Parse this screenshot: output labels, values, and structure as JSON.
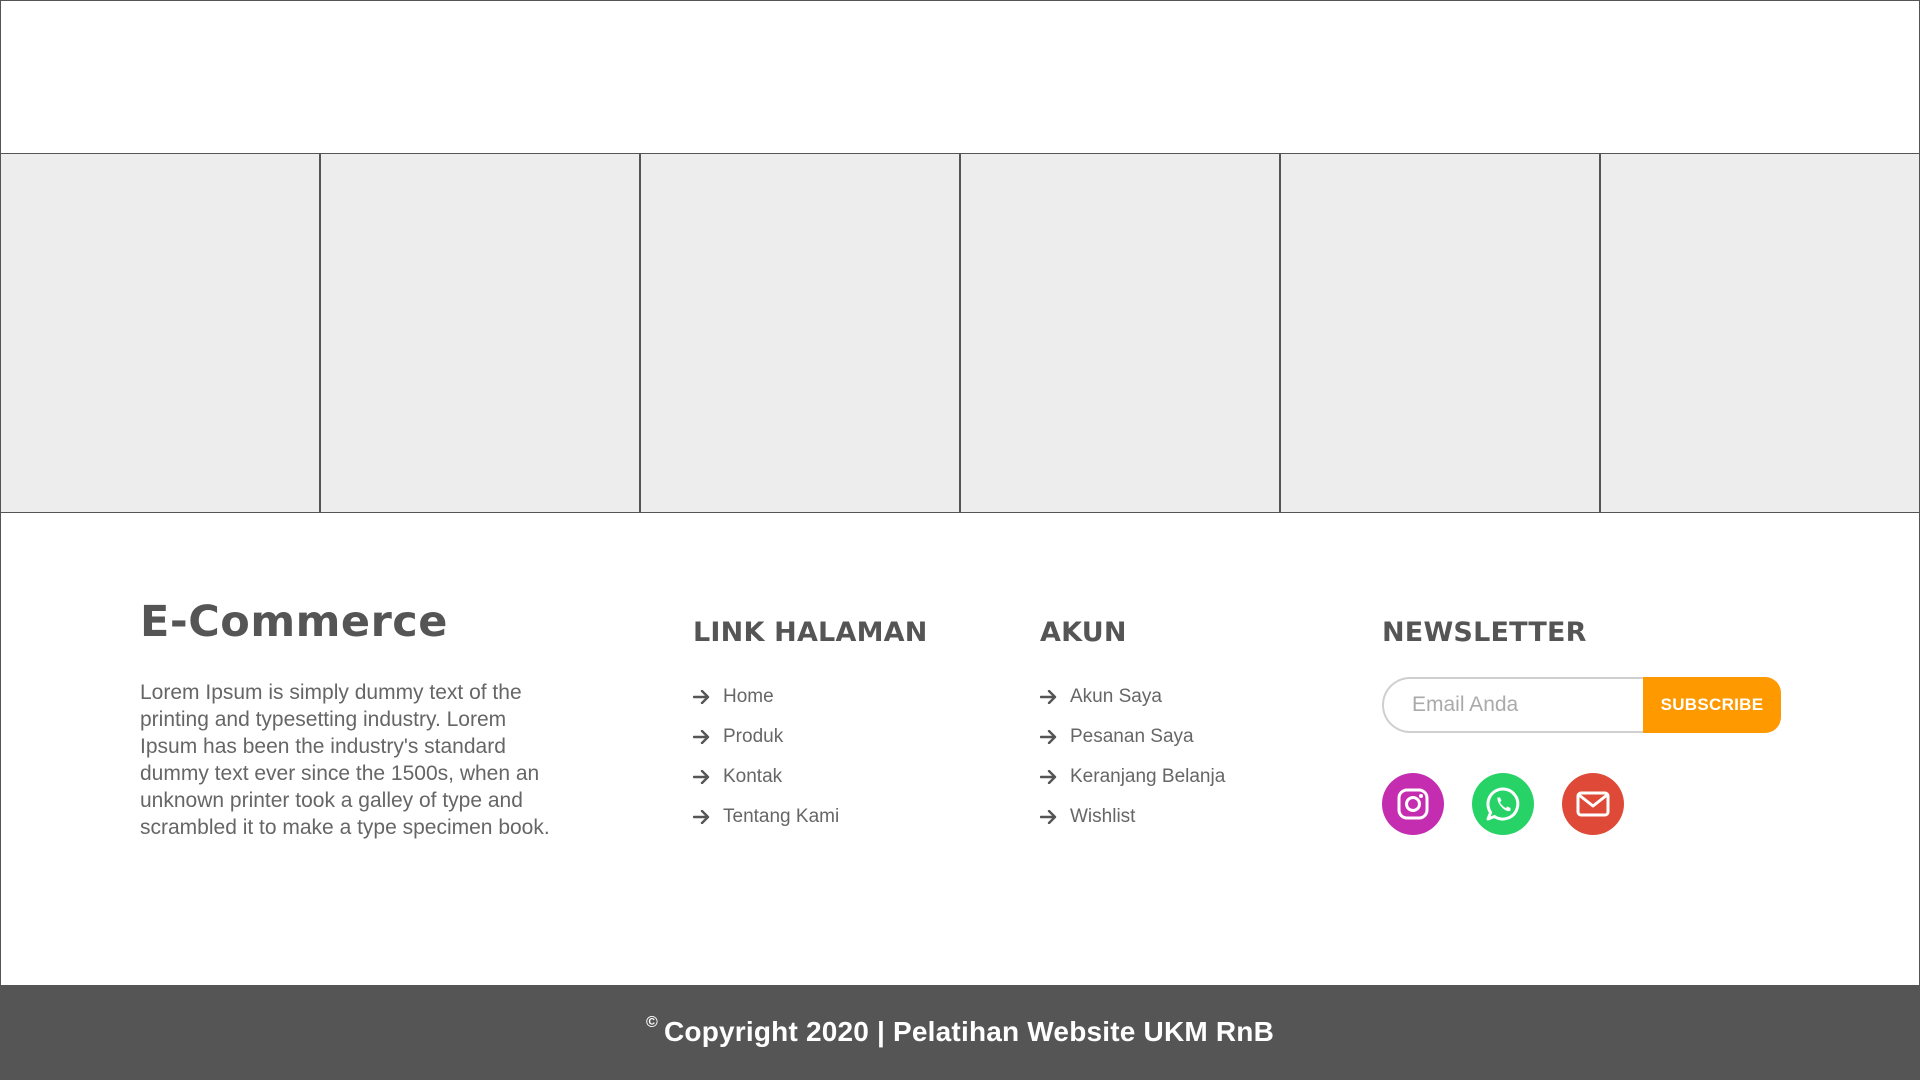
{
  "gallery": {
    "tile_count": 6
  },
  "brand": {
    "title": "E-Commerce",
    "description": "Lorem Ipsum is simply dummy text of the printing and typesetting industry. Lorem Ipsum has been the industry's standard dummy text ever since the 1500s, when an unknown printer took a galley of type and scrambled it to make a type specimen book."
  },
  "link_halaman": {
    "heading": "LINK HALAMAN",
    "items": [
      {
        "label": "Home",
        "icon": "arrow-right-icon"
      },
      {
        "label": "Produk",
        "icon": "arrow-right-icon"
      },
      {
        "label": "Kontak",
        "icon": "arrow-right-icon"
      },
      {
        "label": "Tentang Kami",
        "icon": "arrow-right-icon"
      }
    ]
  },
  "akun": {
    "heading": "AKUN",
    "items": [
      {
        "label": "Akun Saya",
        "icon": "arrow-right-icon"
      },
      {
        "label": "Pesanan Saya",
        "icon": "arrow-right-icon"
      },
      {
        "label": "Keranjang Belanja",
        "icon": "arrow-right-icon"
      },
      {
        "label": "Wishlist",
        "icon": "arrow-right-icon"
      }
    ]
  },
  "newsletter": {
    "heading": "NEWSLETTER",
    "email_placeholder": "Email Anda",
    "email_value": "",
    "subscribe_label": "SUBSCRIBE",
    "subscribe_color": "#ff9900"
  },
  "social": [
    {
      "name": "instagram",
      "icon": "instagram-icon",
      "color": "#c52db1"
    },
    {
      "name": "whatsapp",
      "icon": "whatsapp-icon",
      "color": "#27d366"
    },
    {
      "name": "email",
      "icon": "mail-icon",
      "color": "#df4a38"
    }
  ],
  "copyright": {
    "symbol": "©",
    "text": "Copyright 2020 | Pelatihan Website UKM RnB"
  },
  "colors": {
    "text_dark": "#555555",
    "text_body": "#666666",
    "tile_bg": "#ededed",
    "footer_bar": "#555555"
  }
}
